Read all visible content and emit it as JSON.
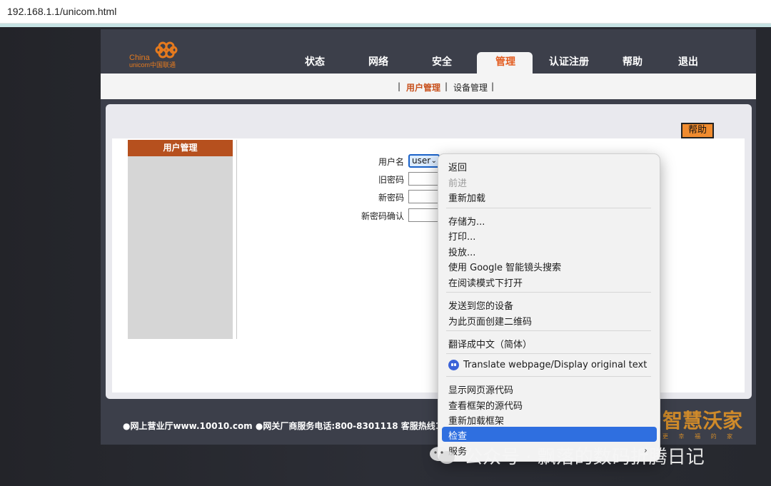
{
  "browser": {
    "url": "192.168.1.1/unicom.html"
  },
  "logo": {
    "line1": "China",
    "line2": "unicom中国联通"
  },
  "nav": {
    "items": [
      "状态",
      "网络",
      "安全",
      "管理",
      "认证注册",
      "帮助",
      "退出"
    ],
    "active": "管理"
  },
  "subnav": {
    "sep1": "|",
    "user_mgmt": "用户管理",
    "sep2": "|",
    "device_mgmt": "设备管理",
    "sep3": "|"
  },
  "help_button": "帮助",
  "sidebar": {
    "title": "用户管理"
  },
  "form": {
    "username_label": "用户名",
    "username_value": "user",
    "old_password_label": "旧密码",
    "new_password_label": "新密码",
    "confirm_password_label": "新密码确认"
  },
  "footer": {
    "text": "●网上营业厅www.10010.com ●网关厂商服务电话:800-8301118 客服热线10010"
  },
  "brand": {
    "name": "智慧沃家",
    "tagline": "更 幸 福 的 家"
  },
  "context_menu": {
    "back": "返回",
    "forward": "前进",
    "reload": "重新加载",
    "save_as": "存储为...",
    "print": "打印...",
    "cast": "投放...",
    "google_lens": "使用 Google 智能镜头搜索",
    "reader_mode": "在阅读模式下打开",
    "send_to_devices": "发送到您的设备",
    "qr_code": "为此页面创建二维码",
    "translate_cn": "翻译成中文（简体）",
    "translate_ext": "Translate webpage/Display original text",
    "view_source": "显示网页源代码",
    "view_frame_source": "查看框架的源代码",
    "reload_frame": "重新加载框架",
    "inspect": "检查",
    "services": "服务",
    "services_arrow": "›"
  },
  "watermark": {
    "text": "公众号 · 飘落的数码折腾日记"
  }
}
